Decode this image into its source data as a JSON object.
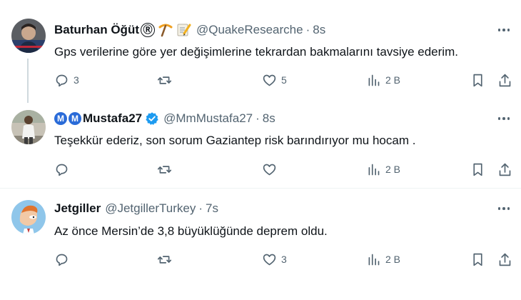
{
  "tweets": [
    {
      "name": "Baturhan Öğüt",
      "handle": "@QuakeResearche",
      "dot": "·",
      "time": "8s",
      "text": "Gps verilerine göre yer değişimlerine tekrardan bakmalarını tavsiye ederim.",
      "replies": "3",
      "retweets": "",
      "likes": "5",
      "views": "2 B",
      "name_badges": [
        "Ⓡ",
        "pick-icon",
        "memo-icon"
      ]
    },
    {
      "name": "Mustafa27",
      "handle": "@MmMustafa27",
      "dot": "·",
      "time": "8s",
      "text": "Teşekkür ederiz, son sorum Gaziantep risk barındırıyor mu hocam .",
      "replies": "",
      "retweets": "",
      "likes": "",
      "views": "2 B",
      "prefix_badges": [
        "M",
        "M"
      ]
    },
    {
      "name": "Jetgiller",
      "handle": "@JetgillerTurkey",
      "dot": "·",
      "time": "7s",
      "text": "Az önce Mersin’de 3,8 büyüklüğünde deprem oldu.",
      "replies": "",
      "retweets": "",
      "likes": "3",
      "views": "2 B"
    }
  ],
  "colors": {
    "text_primary": "#0f1419",
    "text_secondary": "#536471",
    "divider": "#eff3f4",
    "verified": "#1d9bf0",
    "thread_line": "#cfd9de"
  }
}
